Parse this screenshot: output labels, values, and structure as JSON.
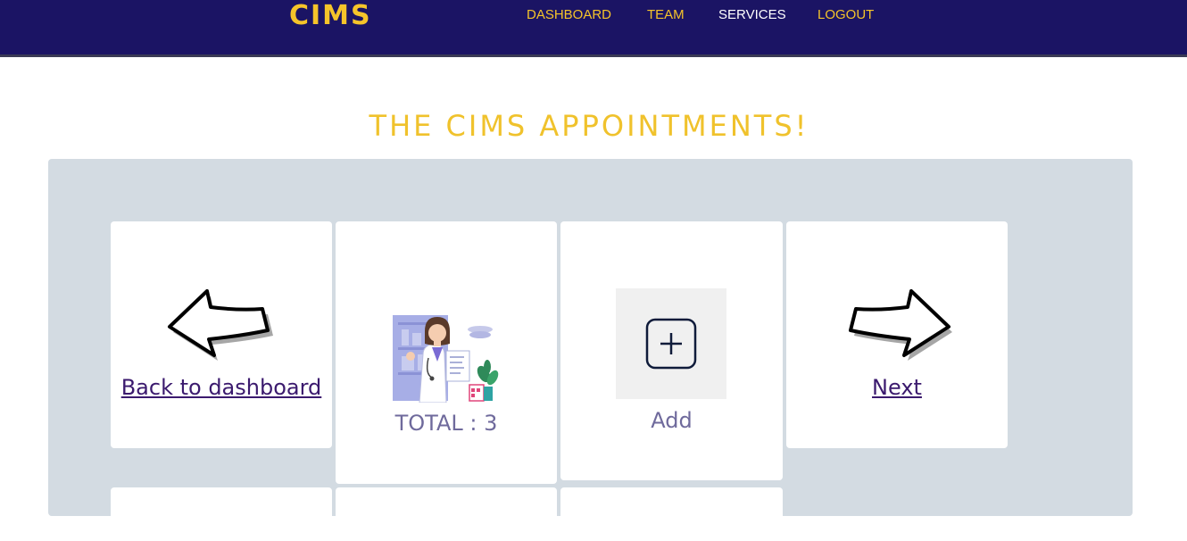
{
  "nav": {
    "brand": "CIMS",
    "links": [
      {
        "label": "DASHBOARD"
      },
      {
        "label": "TEAM"
      },
      {
        "label": "SERVICES"
      },
      {
        "label": "LOGOUT"
      }
    ],
    "active": "SERVICES"
  },
  "page": {
    "title": "THE CIMS APPOINTMENTS!"
  },
  "cards": {
    "back": {
      "label": "Back to dashboard",
      "icon": "arrow-left-icon"
    },
    "total": {
      "label": "TOTAL : 3",
      "icon": "doctor-illustration"
    },
    "add": {
      "label": "Add",
      "icon": "plus-square-icon"
    },
    "next": {
      "label": "Next",
      "icon": "arrow-right-icon"
    }
  },
  "colors": {
    "nav_bg": "#1b1464",
    "accent": "#f5c42a",
    "panel_bg": "#d3dbe2",
    "link": "#3b1a6e",
    "muted_label": "#6f6a9c"
  }
}
